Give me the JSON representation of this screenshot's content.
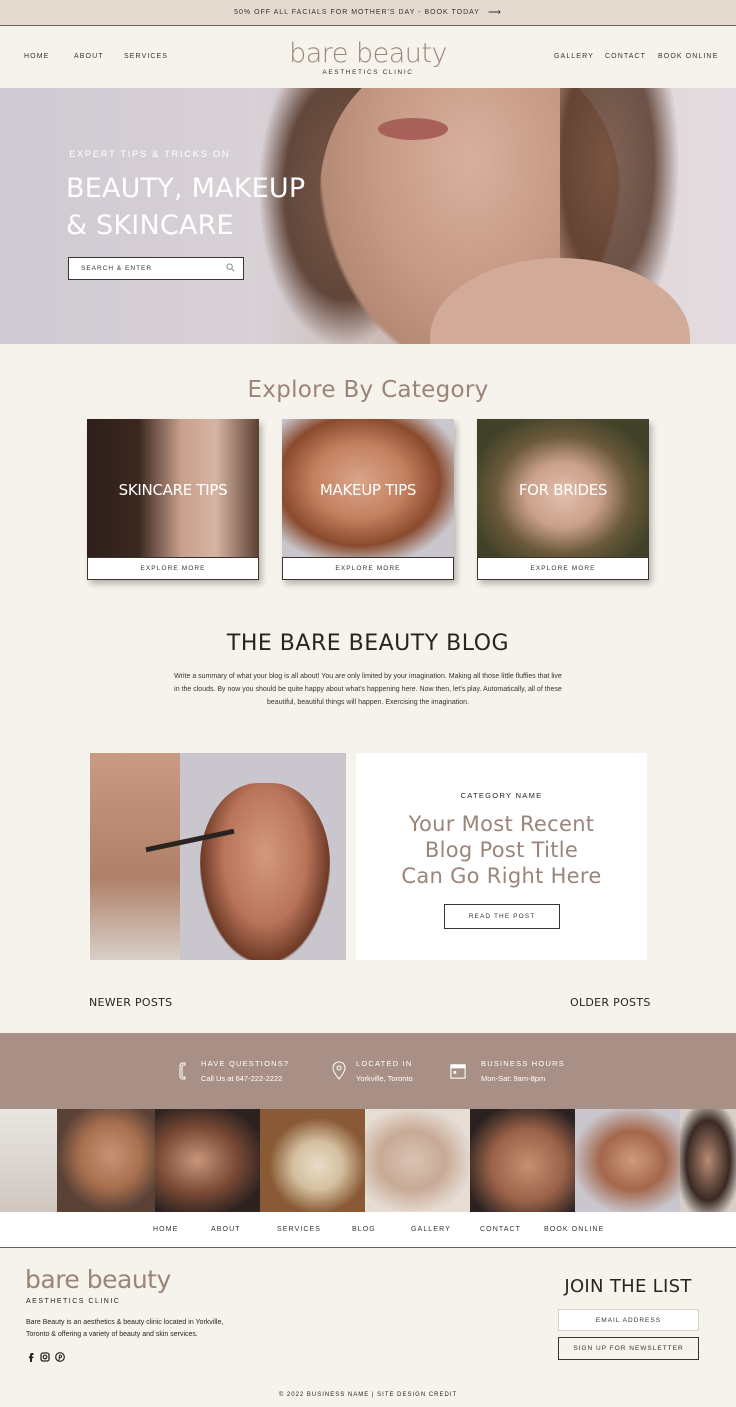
{
  "promo": {
    "text": "50% OFF ALL FACIALS FOR MOTHER'S DAY - BOOK TODAY",
    "arrow": "⟶"
  },
  "nav": {
    "left": [
      "HOME",
      "ABOUT",
      "SERVICES"
    ],
    "right": [
      "GALLERY",
      "CONTACT",
      "BOOK ONLINE"
    ]
  },
  "logo": {
    "name": "bare beauty",
    "sub": "AESTHETICS CLINIC"
  },
  "hero": {
    "kicker": "EXPERT TIPS & TRICKS ON",
    "title_line1": "BEAUTY, MAKEUP",
    "title_line2": "& SKINCARE",
    "search_placeholder": "SEARCH & ENTER"
  },
  "explore": {
    "title": "Explore By Category",
    "categories": [
      {
        "label": "SKINCARE TIPS",
        "button": "EXPLORE MORE"
      },
      {
        "label": "MAKEUP TIPS",
        "button": "EXPLORE MORE"
      },
      {
        "label": "FOR BRIDES",
        "button": "EXPLORE MORE"
      }
    ]
  },
  "blog": {
    "title": "THE BARE BEAUTY BLOG",
    "description": "Write a summary of what your blog is all about! You are only limited by your imagination. Making all those little fluffies that live in the clouds. By now you should be quite happy about what's happening here. Now then, let's play. Automatically, all of these beautiful, beautiful things will happen. Exercising the imagination.",
    "post": {
      "category": "CATEGORY NAME",
      "title_line1": "Your Most Recent",
      "title_line2": "Blog Post Title",
      "title_line3": "Can Go Right Here",
      "button": "READ THE POST"
    },
    "newer": "NEWER POSTS",
    "older": "OLDER POSTS"
  },
  "info": [
    {
      "title": "HAVE QUESTIONS?",
      "value": "Call Us at 647-222-2222",
      "icon": "phone-icon"
    },
    {
      "title": "LOCATED IN",
      "value": "Yorkville, Toronto",
      "icon": "location-pin-icon"
    },
    {
      "title": "BUSINESS HOURS",
      "value": "Mon-Sat: 9am-8pm",
      "icon": "calendar-icon"
    }
  ],
  "footer_nav": [
    "HOME",
    "ABOUT",
    "SERVICES",
    "BLOG",
    "GALLERY",
    "CONTACT",
    "BOOK ONLINE"
  ],
  "footer": {
    "logo": "bare beauty",
    "sub": "AESTHETICS CLINIC",
    "description": "Bare Beauty is an aesthetics & beauty clinic located in Yorkville, Toronto & offering a variety of beauty and skin services.",
    "social": [
      "facebook-icon",
      "instagram-icon",
      "pinterest-icon"
    ],
    "join_title": "JOIN THE LIST",
    "email_placeholder": "EMAIL ADDRESS",
    "signup": "SIGN UP FOR NEWSLETTER",
    "copyright": "© 2022 BUSINESS NAME | SITE DESIGN CREDIT"
  },
  "colors": {
    "accent": "#9b8579",
    "info_bar": "#a89086",
    "background": "#f6f2ec",
    "promo_bar": "#e3d9cf"
  }
}
